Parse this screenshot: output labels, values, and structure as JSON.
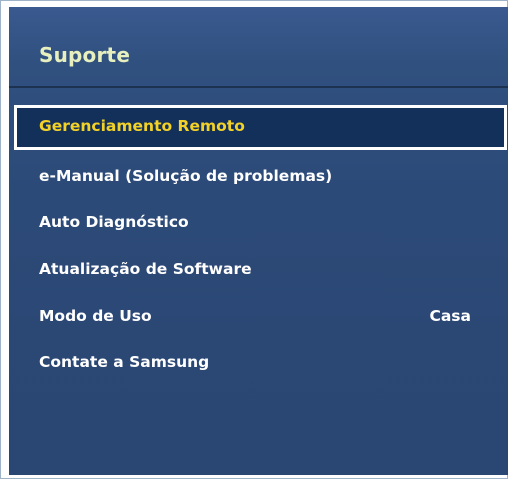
{
  "menu": {
    "title": "Suporte",
    "items": [
      {
        "label": "Gerenciamento Remoto",
        "value": "",
        "selected": true
      },
      {
        "label": "e-Manual (Solução de problemas)",
        "value": "",
        "selected": false
      },
      {
        "label": "Auto Diagnóstico",
        "value": "",
        "selected": false
      },
      {
        "label": "Atualização de Software",
        "value": "",
        "selected": false
      },
      {
        "label": "Modo de Uso",
        "value": "Casa",
        "selected": false
      },
      {
        "label": "Contate a Samsung",
        "value": "",
        "selected": false
      }
    ]
  },
  "colors": {
    "title": "#e6efbd",
    "selected_text": "#f3d228",
    "selected_bg": "#13305a",
    "panel_bg": "#2c4a78"
  }
}
